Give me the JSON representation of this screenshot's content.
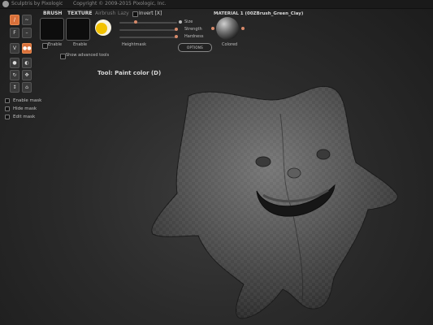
{
  "window": {
    "title": "Sculptris by Pixologic",
    "copyright": "Copyright © 2009-2015 Pixologic, Inc."
  },
  "brush_panel": {
    "brush_label": "BRUSH",
    "texture_label": "TEXTURE",
    "airbrush_label": "Airbrush",
    "lazy_label": "Lazy",
    "invert_label": "Invert [X]",
    "brush_enable": "Enable",
    "texture_enable": "Enable",
    "show_advanced": "Show advanced tools",
    "heightmask_label": "Heightmask",
    "paint_color": "#f2c200"
  },
  "sliders": {
    "size_label": "Size",
    "strength_label": "Strength",
    "hardness_label": "Hardness",
    "size_value_pct": 30,
    "strength_value_pct": 100,
    "hardness_value_pct": 100
  },
  "material": {
    "header": "MATERIAL 1 (00ZBrush_Green_Clay)",
    "colored_label": "Colored",
    "options_button": "OPTIONS"
  },
  "status": {
    "tool_text": "Tool: Paint color (D)"
  },
  "mask": {
    "enable": "Enable mask",
    "hide": "Hide mask",
    "edit": "Edit mask"
  },
  "colors": {
    "accent": "#d9703a",
    "slider_dot": "#d88a6a"
  }
}
